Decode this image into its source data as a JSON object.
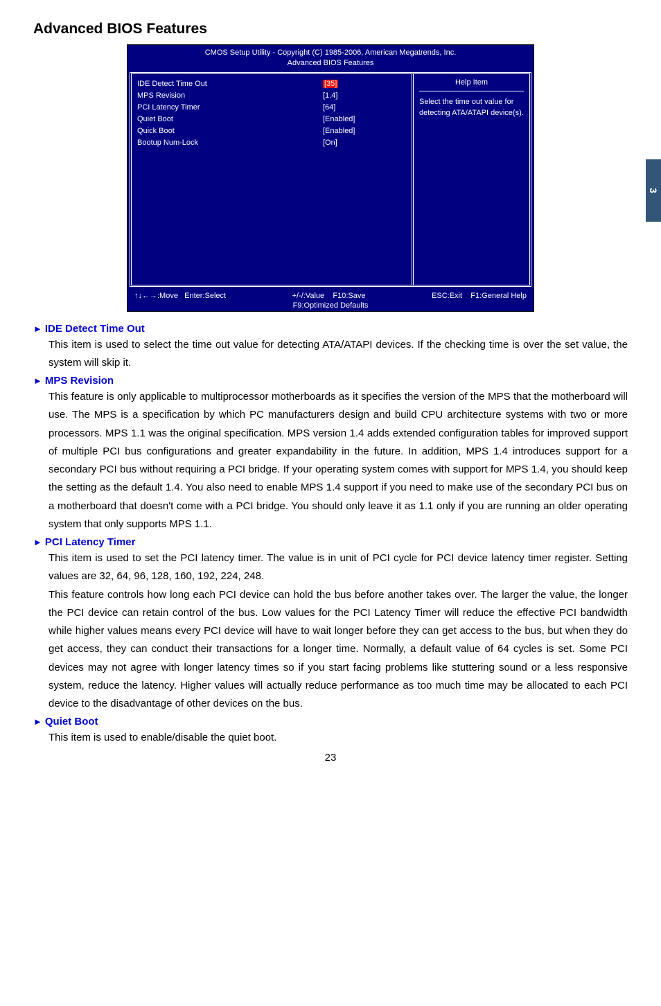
{
  "section_title": "Advanced BIOS Features",
  "side_tab": "3",
  "page_number": "23",
  "bios": {
    "header_line1": "CMOS Setup Utility - Copyright (C) 1985-2006, American Megatrends, Inc.",
    "header_line2": "Advanced BIOS Features",
    "items": [
      {
        "label": "IDE Detect Time Out",
        "value": "[35]",
        "highlight": true
      },
      {
        "label": "MPS Revision",
        "value": "[1.4]"
      },
      {
        "label": "PCI Latency Timer",
        "value": "[64]"
      },
      {
        "label": "Quiet Boot",
        "value": "[Enabled]"
      },
      {
        "label": "Quick Boot",
        "value": "[Enabled]"
      },
      {
        "label": "Bootup Num-Lock",
        "value": "[On]"
      }
    ],
    "help_title": "Help Item",
    "help_text": "Select the time out value for detecting ATA/ATAPI device(s).",
    "footer": {
      "move": "↑↓←→:Move",
      "enter": "Enter:Select",
      "value": "+/-/:Value",
      "save": "F10:Save",
      "exit": "ESC:Exit",
      "help": "F1:General Help",
      "defaults": "F9:Optimized Defaults"
    }
  },
  "descriptions": {
    "ide_title": "IDE Detect Time Out",
    "ide_body": "This item is used to select the time out value for detecting ATA/ATAPI devices. If the checking time is over the set value, the system will skip it.",
    "mps_title": "MPS Revision",
    "mps_body": "This feature is only applicable to multiprocessor motherboards as it specifies the version of the MPS that the motherboard will use. The MPS is a specification by which PC manufacturers design and build CPU architecture systems with two or more processors. MPS 1.1 was the original specification. MPS version 1.4 adds extended configuration tables for improved support of multiple PCI bus configurations and greater expandability in the future. In addition, MPS 1.4 introduces support for a secondary PCI bus without requiring a PCI bridge. If your operating system comes with support for MPS 1.4, you should keep the setting as the default 1.4. You also need to enable MPS 1.4 support if you need to make use of the secondary PCI bus on a motherboard that doesn't come with a PCI bridge. You should only leave it as 1.1 only if you are running an older operating system that only supports MPS 1.1.",
    "pci_title": "PCI Latency Timer",
    "pci_body": "This item is used to set the PCI latency timer. The value is in unit of PCI cycle for PCI device latency timer register. Setting values are 32, 64, 96, 128, 160, 192, 224, 248.\nThis feature controls how long each PCI device can hold the bus before another takes over. The larger the value, the longer the PCI device can retain control of the bus. Low values for the PCI Latency Timer will reduce the effective PCI bandwidth while higher values means every PCI device will have to wait longer before they can get access to the bus, but when they do get access, they can conduct their transactions for a longer time. Normally, a default value of 64 cycles is set. Some PCI devices may not agree with longer latency times so if you start facing problems like stuttering sound or a less responsive system, reduce the latency. Higher values will actually reduce performance as too much time may be allocated to each PCI device to the disadvantage of other devices on the bus.",
    "quiet_title": "Quiet Boot",
    "quiet_body": "This item is used to enable/disable the quiet boot."
  }
}
